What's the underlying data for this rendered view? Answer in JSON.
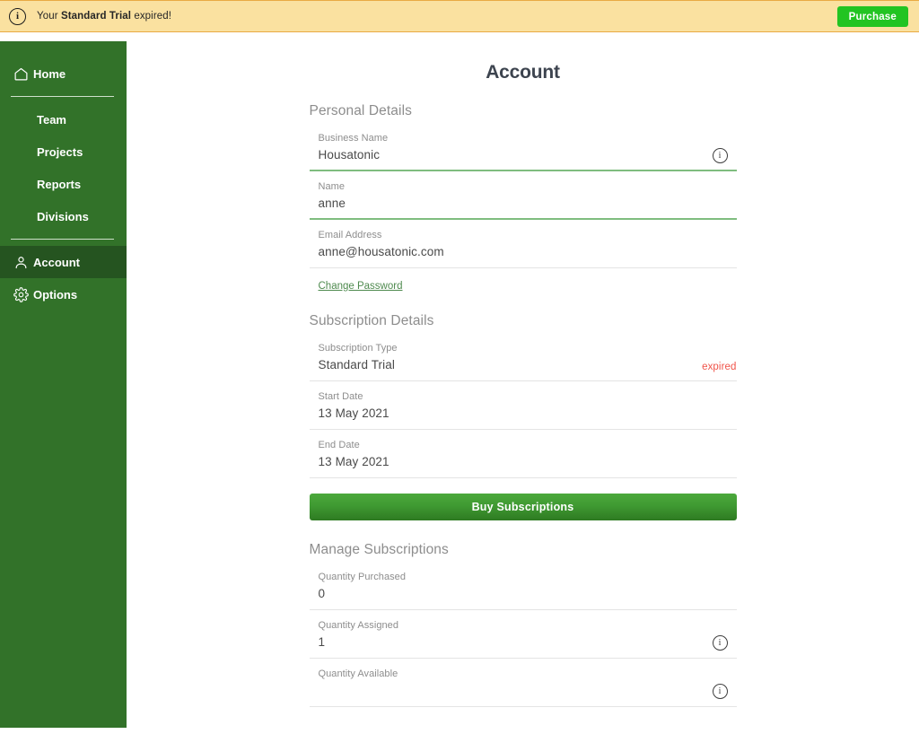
{
  "banner": {
    "icon": "info-circle-icon",
    "text_prefix": "Your ",
    "text_bold": "Standard Trial",
    "text_suffix": " expired!",
    "purchase_label": "Purchase",
    "background_color": "#fae1a0",
    "border_color": "#e8aa44",
    "purchase_color": "#22c422"
  },
  "sidebar": {
    "background_color": "#327229",
    "active_background_color": "#255420",
    "items": [
      {
        "label": "Home",
        "icon": "home-icon",
        "active": false
      },
      {
        "label": "Team",
        "icon": "",
        "active": false
      },
      {
        "label": "Projects",
        "icon": "",
        "active": false
      },
      {
        "label": "Reports",
        "icon": "",
        "active": false
      },
      {
        "label": "Divisions",
        "icon": "",
        "active": false
      },
      {
        "label": "Account",
        "icon": "person-icon",
        "active": true
      },
      {
        "label": "Options",
        "icon": "gear-icon",
        "active": false
      }
    ]
  },
  "main": {
    "title": "Account",
    "personal_details": {
      "heading": "Personal Details",
      "fields": [
        {
          "label": "Business Name",
          "value": "Housatonic",
          "underline": "green",
          "info_icon": true
        },
        {
          "label": "Name",
          "value": "anne",
          "underline": "green",
          "info_icon": false
        },
        {
          "label": "Email Address",
          "value": "anne@housatonic.com",
          "underline": "gray",
          "info_icon": false
        }
      ],
      "change_password_label": "Change Password"
    },
    "subscription_details": {
      "heading": "Subscription Details",
      "fields": [
        {
          "label": "Subscription Type",
          "value": "Standard Trial",
          "underline": "gray",
          "status": "expired",
          "status_color": "#f0544a"
        },
        {
          "label": "Start Date",
          "value": "13 May 2021",
          "underline": "gray"
        },
        {
          "label": "End Date",
          "value": "13 May 2021",
          "underline": "gray"
        }
      ],
      "buy_button_label": "Buy Subscriptions"
    },
    "manage_subscriptions": {
      "heading": "Manage Subscriptions",
      "fields": [
        {
          "label": "Quantity Purchased",
          "value": "0",
          "underline": "gray",
          "info_icon": false
        },
        {
          "label": "Quantity Assigned",
          "value": "1",
          "underline": "gray",
          "info_icon": true
        },
        {
          "label": "Quantity Available",
          "value": "",
          "underline": "gray",
          "info_icon": true
        }
      ]
    }
  }
}
